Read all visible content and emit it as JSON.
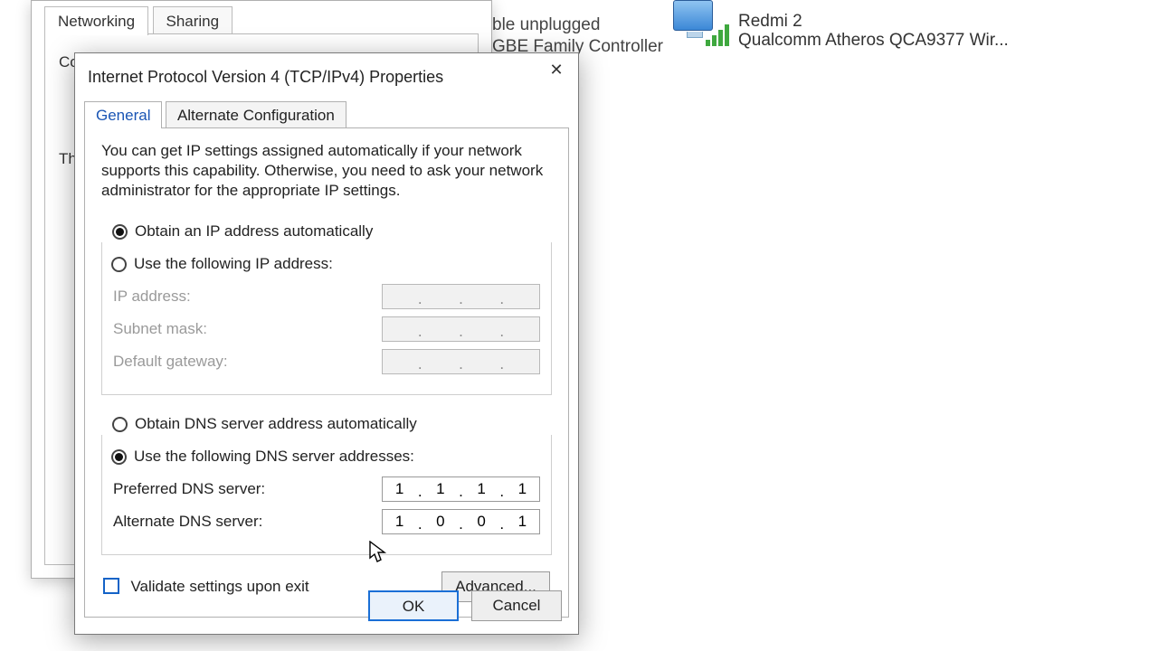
{
  "background": {
    "status_line1": "ble unplugged",
    "status_line2": "GBE Family Controller",
    "wifi": {
      "name": "Redmi 2",
      "adapter": "Qualcomm Atheros QCA9377 Wir..."
    }
  },
  "parent_dialog": {
    "tabs": [
      "Networking",
      "Sharing"
    ],
    "connect_label": "Conn",
    "th_text": "Th"
  },
  "dialog": {
    "title": "Internet Protocol Version 4 (TCP/IPv4) Properties",
    "tabs": {
      "general": "General",
      "alternate": "Alternate Configuration"
    },
    "description": "You can get IP settings assigned automatically if your network supports this capability. Otherwise, you need to ask your network administrator for the appropriate IP settings.",
    "ip": {
      "auto_label": "Obtain an IP address automatically",
      "manual_label": "Use the following IP address:",
      "ip_label": "IP address:",
      "subnet_label": "Subnet mask:",
      "gateway_label": "Default gateway:",
      "ip_value": [
        "",
        "",
        "",
        ""
      ],
      "subnet_value": [
        "",
        "",
        "",
        ""
      ],
      "gateway_value": [
        "",
        "",
        "",
        ""
      ]
    },
    "dns": {
      "auto_label": "Obtain DNS server address automatically",
      "manual_label": "Use the following DNS server addresses:",
      "preferred_label": "Preferred DNS server:",
      "alternate_label": "Alternate DNS server:",
      "preferred_value": [
        "1",
        "1",
        "1",
        "1"
      ],
      "alternate_value": [
        "1",
        "0",
        "0",
        "1"
      ]
    },
    "validate_label": "Validate settings upon exit",
    "advanced_label": "Advanced...",
    "ok_label": "OK",
    "cancel_label": "Cancel"
  }
}
